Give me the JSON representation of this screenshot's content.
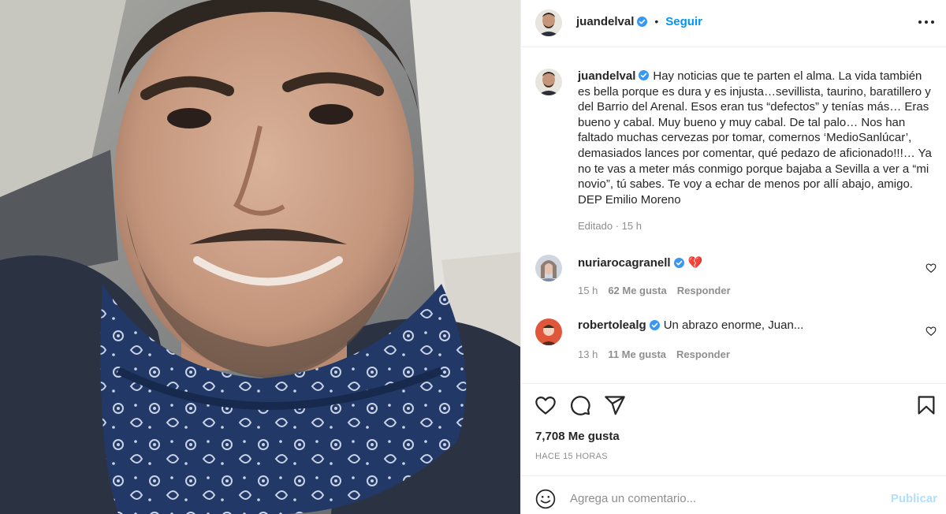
{
  "post": {
    "username": "juandelval",
    "follow_label": "Seguir",
    "separator": "•",
    "caption_text": "Hay noticias que te parten el alma. La vida también es bella porque es dura y es injusta…sevillista, taurino, baratillero y del Barrio del Arenal. Esos eran tus “defectos” y tenías más… Eras bueno y cabal. Muy bueno y muy cabal. De tal palo… Nos han faltado muchas cervezas por tomar, comernos ‘MedioSanlúcar’, demasiados lances por comentar, qué pedazo de aficionado!!!… Ya no te vas a meter más conmigo porque bajaba a Sevilla a ver a “mi novio”, tú sabes. Te voy a echar de menos por allí abajo, amigo. DEP Emilio Moreno",
    "caption_meta": "Editado · 15 h",
    "likes": "7,708 Me gusta",
    "posted_time": "HACE 15 HORAS"
  },
  "comments": [
    {
      "username": "nuriarocagranell",
      "text": "💔",
      "time": "15 h",
      "likes": "62 Me gusta",
      "reply_label": "Responder"
    },
    {
      "username": "robertolealg",
      "text": "Un abrazo enorme, Juan...",
      "time": "13 h",
      "likes": "11 Me gusta",
      "reply_label": "Responder"
    }
  ],
  "add_comment": {
    "placeholder": "Agrega un comentario...",
    "submit_label": "Publicar"
  },
  "icons": {
    "verified": "verified-badge-icon",
    "more": "more-options-icon",
    "like": "heart-icon",
    "comment": "comment-bubble-icon",
    "share": "paper-plane-icon",
    "save": "bookmark-icon",
    "emoji": "smiley-icon"
  },
  "colors": {
    "link_blue": "#0095f6",
    "publish_disabled": "#b2dffc",
    "muted": "#8e8e8e",
    "text": "#262626",
    "verified_badge": "#3897f0"
  }
}
